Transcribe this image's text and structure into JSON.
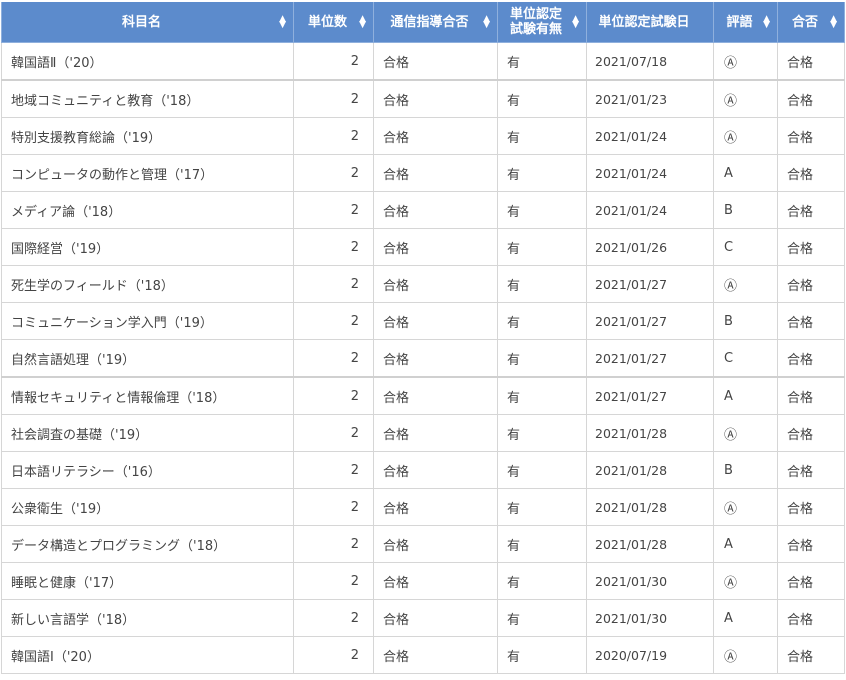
{
  "headers": [
    {
      "label": "科目名"
    },
    {
      "label": "単位数"
    },
    {
      "label": "通信指導合否"
    },
    {
      "label": "単位認定\n試験有無"
    },
    {
      "label": "単位認定試験日"
    },
    {
      "label": "評語"
    },
    {
      "label": "合否"
    }
  ],
  "rows": [
    {
      "name": "韓国語Ⅱ（'20）",
      "credits": "2",
      "correspondence": "合格",
      "exam": "有",
      "date": "2021/07/18",
      "grade": "Ⓐ",
      "result": "合格"
    },
    {
      "name": "地域コミュニティと教育（'18）",
      "credits": "2",
      "correspondence": "合格",
      "exam": "有",
      "date": "2021/01/23",
      "grade": "Ⓐ",
      "result": "合格"
    },
    {
      "name": "特別支援教育総論（'19）",
      "credits": "2",
      "correspondence": "合格",
      "exam": "有",
      "date": "2021/01/24",
      "grade": "Ⓐ",
      "result": "合格"
    },
    {
      "name": "コンピュータの動作と管理（'17）",
      "credits": "2",
      "correspondence": "合格",
      "exam": "有",
      "date": "2021/01/24",
      "grade": "A",
      "result": "合格"
    },
    {
      "name": "メディア論（'18）",
      "credits": "2",
      "correspondence": "合格",
      "exam": "有",
      "date": "2021/01/24",
      "grade": "B",
      "result": "合格"
    },
    {
      "name": "国際経営（'19）",
      "credits": "2",
      "correspondence": "合格",
      "exam": "有",
      "date": "2021/01/26",
      "grade": "C",
      "result": "合格"
    },
    {
      "name": "死生学のフィールド（'18）",
      "credits": "2",
      "correspondence": "合格",
      "exam": "有",
      "date": "2021/01/27",
      "grade": "Ⓐ",
      "result": "合格"
    },
    {
      "name": "コミュニケーション学入門（'19）",
      "credits": "2",
      "correspondence": "合格",
      "exam": "有",
      "date": "2021/01/27",
      "grade": "B",
      "result": "合格"
    },
    {
      "name": "自然言語処理（'19）",
      "credits": "2",
      "correspondence": "合格",
      "exam": "有",
      "date": "2021/01/27",
      "grade": "C",
      "result": "合格"
    },
    {
      "name": "情報セキュリティと情報倫理（'18）",
      "credits": "2",
      "correspondence": "合格",
      "exam": "有",
      "date": "2021/01/27",
      "grade": "A",
      "result": "合格"
    },
    {
      "name": "社会調査の基礎（'19）",
      "credits": "2",
      "correspondence": "合格",
      "exam": "有",
      "date": "2021/01/28",
      "grade": "Ⓐ",
      "result": "合格"
    },
    {
      "name": "日本語リテラシー（'16）",
      "credits": "2",
      "correspondence": "合格",
      "exam": "有",
      "date": "2021/01/28",
      "grade": "B",
      "result": "合格"
    },
    {
      "name": "公衆衛生（'19）",
      "credits": "2",
      "correspondence": "合格",
      "exam": "有",
      "date": "2021/01/28",
      "grade": "Ⓐ",
      "result": "合格"
    },
    {
      "name": "データ構造とプログラミング（'18）",
      "credits": "2",
      "correspondence": "合格",
      "exam": "有",
      "date": "2021/01/28",
      "grade": "A",
      "result": "合格"
    },
    {
      "name": "睡眠と健康（'17）",
      "credits": "2",
      "correspondence": "合格",
      "exam": "有",
      "date": "2021/01/30",
      "grade": "Ⓐ",
      "result": "合格"
    },
    {
      "name": "新しい言語学（'18）",
      "credits": "2",
      "correspondence": "合格",
      "exam": "有",
      "date": "2021/01/30",
      "grade": "A",
      "result": "合格"
    },
    {
      "name": "韓国語Ⅰ（'20）",
      "credits": "2",
      "correspondence": "合格",
      "exam": "有",
      "date": "2020/07/19",
      "grade": "Ⓐ",
      "result": "合格"
    }
  ],
  "separator_row_indices": [
    1,
    9
  ],
  "colors": {
    "header_bg": "#5c8bcc",
    "header_text": "#ffffff",
    "cell_text": "#444444",
    "border": "#d6d6d6"
  }
}
